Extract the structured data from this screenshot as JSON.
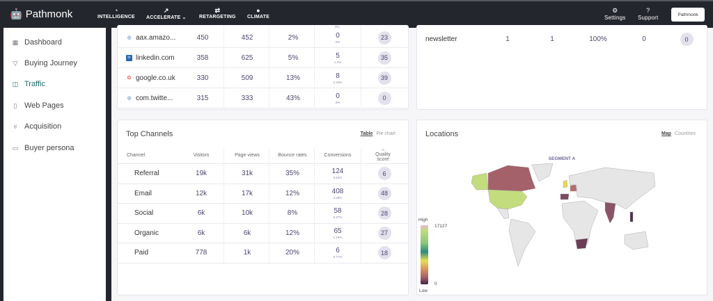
{
  "header": {
    "brand": "Pathmonk",
    "nav": [
      {
        "label": "INTELLIGENCE",
        "icon": "intelligence-icon"
      },
      {
        "label": "ACCELERATE",
        "icon": "trend-icon"
      },
      {
        "label": "RETARGETING",
        "icon": "repeat-icon"
      },
      {
        "label": "CLIMATE",
        "icon": "globe-icon"
      }
    ],
    "settings": "Settings",
    "support": "Support",
    "account_logo": "Pathmonk"
  },
  "sidebar": {
    "items": [
      {
        "label": "Dashboard",
        "icon": "grid-icon"
      },
      {
        "label": "Buying Journey",
        "icon": "funnel-icon"
      },
      {
        "label": "Traffic",
        "icon": "chart-icon",
        "active": true
      },
      {
        "label": "Web Pages",
        "icon": "file-icon"
      },
      {
        "label": "Acquisition",
        "icon": "trophy-icon"
      },
      {
        "label": "Buyer persona",
        "icon": "id-card-icon"
      }
    ]
  },
  "referrers": {
    "partial_top_sub": "0%",
    "rows": [
      {
        "name": "aax.amazo...",
        "icon": "globe-icon",
        "visitors": "450",
        "page_views": "452",
        "bounce": "2%",
        "conversions": "0",
        "conv_rate": "0%",
        "quality": "23"
      },
      {
        "name": "linkedin.com",
        "icon": "linkedin-icon",
        "visitors": "358",
        "page_views": "625",
        "bounce": "5%",
        "conversions": "5",
        "conv_rate": "1.4%",
        "quality": "35"
      },
      {
        "name": "google.co.uk",
        "icon": "google-icon",
        "visitors": "330",
        "page_views": "509",
        "bounce": "13%",
        "conversions": "8",
        "conv_rate": "2.42%",
        "quality": "39"
      },
      {
        "name": "com.twitte...",
        "icon": "globe-icon",
        "visitors": "315",
        "page_views": "333",
        "bounce": "43%",
        "conversions": "0",
        "conv_rate": "0%",
        "quality": "0"
      }
    ]
  },
  "campaigns": {
    "rows": [
      {
        "name": "newsletter",
        "visitors": "1",
        "page_views": "1",
        "bounce": "100%",
        "conversions": "0",
        "quality": "0"
      }
    ]
  },
  "top_channels": {
    "title": "Top Channels",
    "view_table": "Table",
    "view_pie": "Pie chart",
    "columns": [
      "Channel",
      "Visitors",
      "Page views",
      "Bounce rates",
      "Conversions",
      "Quality score"
    ],
    "rows": [
      {
        "name": "Referral",
        "visitors": "19k",
        "page_views": "31k",
        "bounce": "35%",
        "conversions": "124",
        "conv_rate": "0.64%",
        "quality": "6"
      },
      {
        "name": "Email",
        "visitors": "12k",
        "page_views": "17k",
        "bounce": "12%",
        "conversions": "408",
        "conv_rate": "3.29%",
        "quality": "48"
      },
      {
        "name": "Social",
        "visitors": "6k",
        "page_views": "10k",
        "bounce": "8%",
        "conversions": "58",
        "conv_rate": "0.97%",
        "quality": "28"
      },
      {
        "name": "Organic",
        "visitors": "6k",
        "page_views": "6k",
        "bounce": "12%",
        "conversions": "65",
        "conv_rate": "1.15%",
        "quality": "27"
      },
      {
        "name": "Paid",
        "visitors": "778",
        "page_views": "1k",
        "bounce": "20%",
        "conversions": "6",
        "conv_rate": "0.77%",
        "quality": "18"
      }
    ]
  },
  "locations": {
    "title": "Locations",
    "view_map": "Map",
    "view_countries": "Countries",
    "segment": "SEGMENT A",
    "legend": {
      "high": "High",
      "low": "Low",
      "max": "17127",
      "min": "0"
    },
    "colors": {
      "usa": "#c3dc7e",
      "canada": "#a5616a",
      "uk": "#e8d84a",
      "germany": "#b66a6a",
      "spain": "#7c4a60",
      "india": "#8a5468",
      "south_africa": "#6b3d57",
      "philippines": "#4e2f47",
      "other": "#e6e6e6"
    }
  }
}
